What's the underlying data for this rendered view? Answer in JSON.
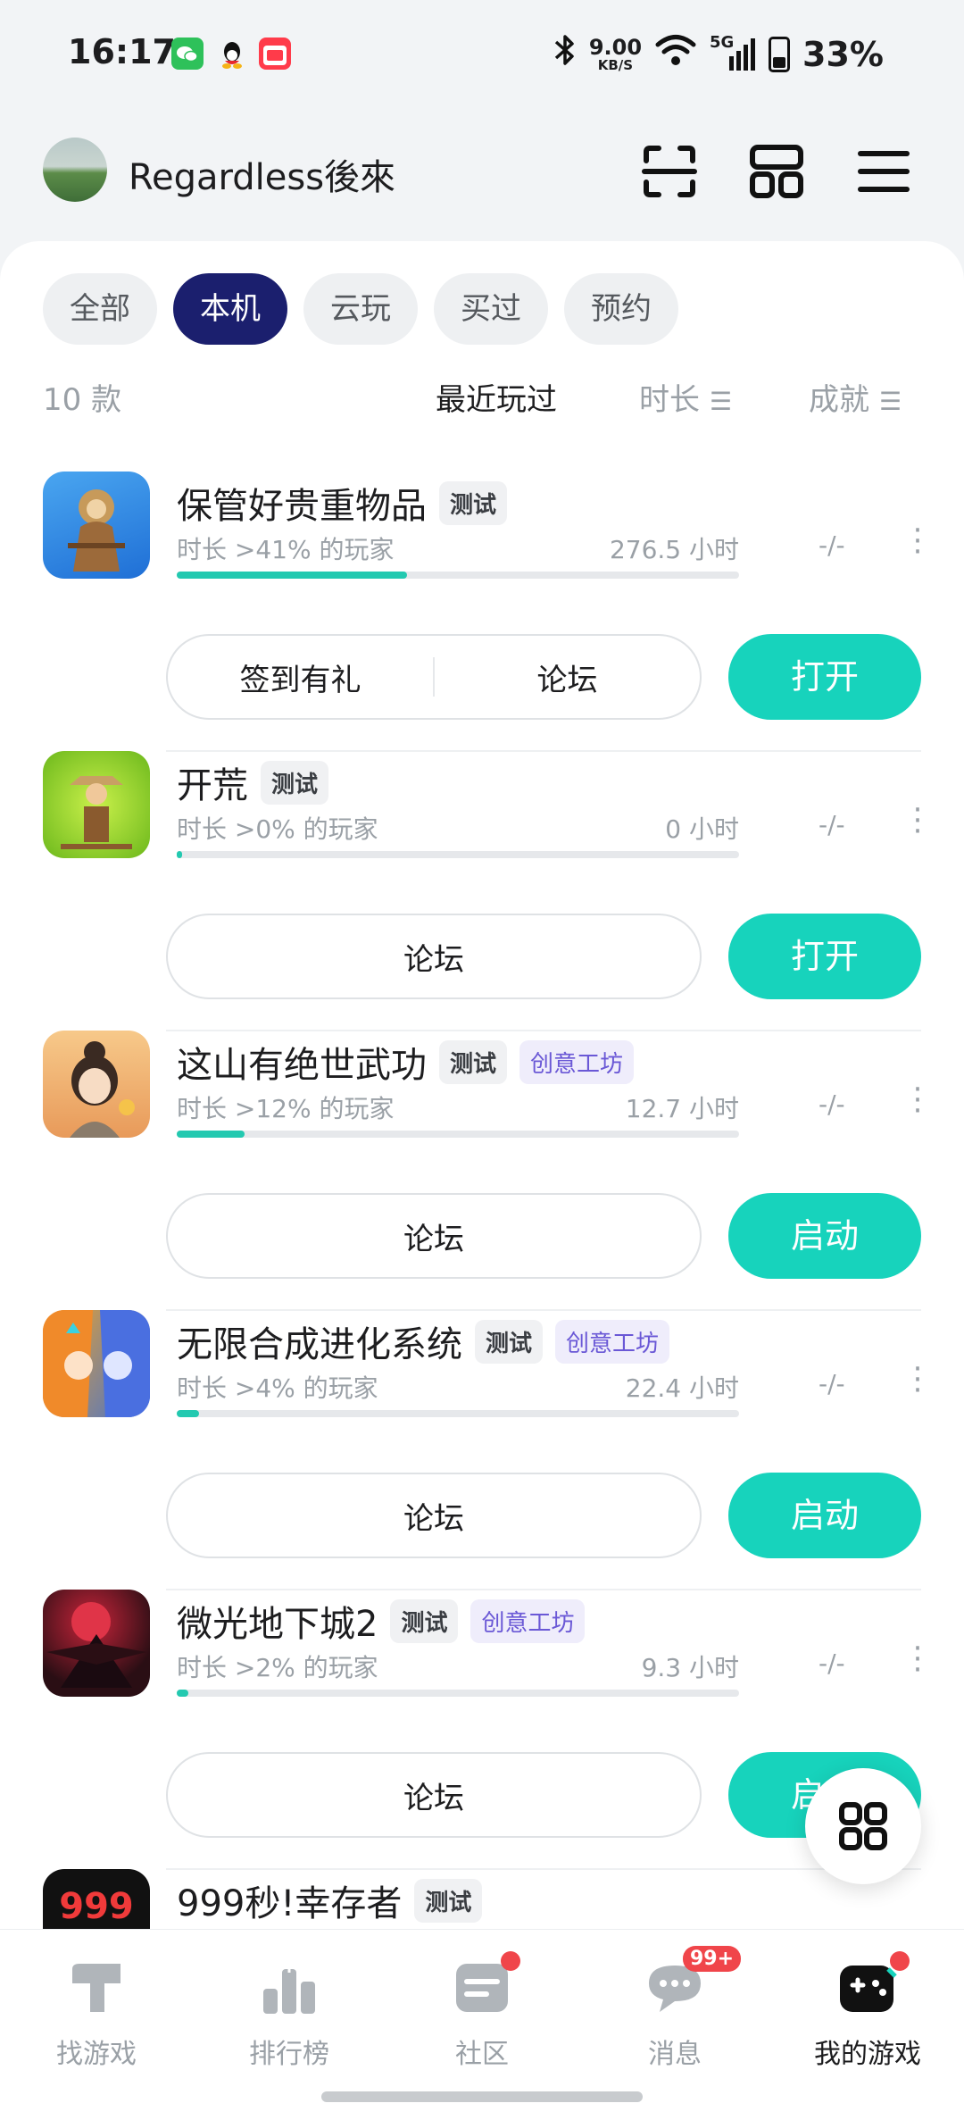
{
  "status_bar": {
    "time": "16:17",
    "speed_value": "9.00",
    "speed_unit": "KB/S",
    "network": "5G",
    "battery": "33%",
    "icons": [
      "wechat-icon",
      "qq-icon",
      "shop-618-icon",
      "bluetooth-icon",
      "wifi-icon",
      "signal-icon",
      "battery-icon"
    ]
  },
  "header": {
    "username": "Regardless後來",
    "icons": [
      "scan-icon",
      "layout-icon",
      "menu-icon"
    ]
  },
  "tabs": [
    {
      "label": "全部",
      "active": false
    },
    {
      "label": "本机",
      "active": true
    },
    {
      "label": "云玩",
      "active": false
    },
    {
      "label": "买过",
      "active": false
    },
    {
      "label": "预约",
      "active": false
    }
  ],
  "sortbar": {
    "count": "10 款",
    "recent": "最近玩过",
    "duration": "时长",
    "achievement": "成就"
  },
  "games": [
    {
      "title": "保管好贵重物品",
      "badges": [
        "测试"
      ],
      "subtitle": "时长 >41% 的玩家",
      "hours": "276.5 小时",
      "progress": 0.41,
      "achievement": "-/-",
      "pills": [
        "签到有礼",
        "论坛"
      ],
      "action": "打开"
    },
    {
      "title": "开荒",
      "badges": [
        "测试"
      ],
      "subtitle": "时长 >0% 的玩家",
      "hours": "0 小时",
      "progress": 0.01,
      "achievement": "-/-",
      "pills": [
        "论坛"
      ],
      "action": "打开"
    },
    {
      "title": "这山有绝世武功",
      "badges": [
        "测试",
        "创意工坊"
      ],
      "subtitle": "时长 >12% 的玩家",
      "hours": "12.7 小时",
      "progress": 0.12,
      "achievement": "-/-",
      "pills": [
        "论坛"
      ],
      "action": "启动"
    },
    {
      "title": "无限合成进化系统",
      "badges": [
        "测试",
        "创意工坊"
      ],
      "subtitle": "时长 >4% 的玩家",
      "hours": "22.4 小时",
      "progress": 0.04,
      "achievement": "-/-",
      "pills": [
        "论坛"
      ],
      "action": "启动"
    },
    {
      "title": "微光地下城2",
      "badges": [
        "测试",
        "创意工坊"
      ],
      "subtitle": "时长 >2% 的玩家",
      "hours": "9.3 小时",
      "progress": 0.02,
      "achievement": "-/-",
      "pills": [
        "论坛"
      ],
      "action": "启动"
    },
    {
      "title": "999秒!幸存者",
      "badges": [
        "测试"
      ],
      "icon_text": "999"
    }
  ],
  "colors": {
    "accent": "#17d3bc",
    "active_tab": "#1b1f6e",
    "workshop_badge": "#6a58d6"
  },
  "bottom_nav": [
    {
      "label": "找游戏",
      "icon": "find-game-icon",
      "active": false
    },
    {
      "label": "排行榜",
      "icon": "ranking-icon",
      "active": false
    },
    {
      "label": "社区",
      "icon": "community-icon",
      "active": false,
      "dot": true
    },
    {
      "label": "消息",
      "icon": "message-icon",
      "active": false,
      "badge": "99+"
    },
    {
      "label": "我的游戏",
      "icon": "my-games-icon",
      "active": true,
      "dot": true
    }
  ]
}
